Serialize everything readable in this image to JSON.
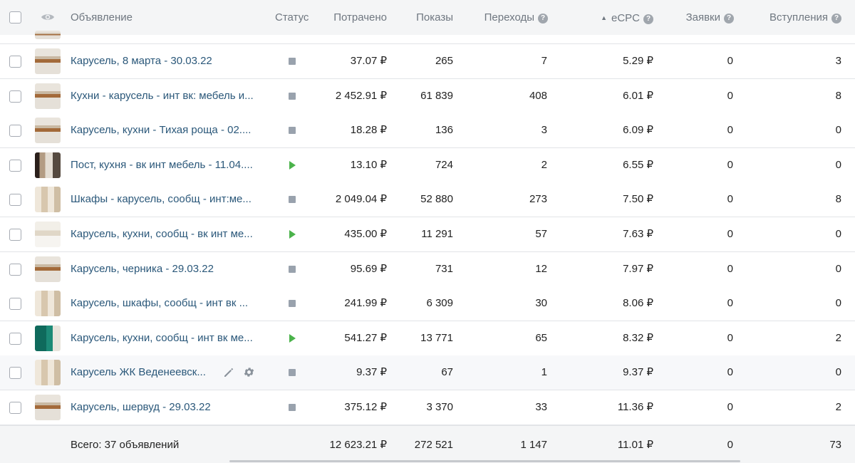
{
  "header": {
    "ad": "Объявление",
    "status": "Статус",
    "spent": "Потрачено",
    "shows": "Показы",
    "clicks": "Переходы",
    "ecpc": "eCPC",
    "leads": "Заявки",
    "joins": "Вступления",
    "help_glyph": "?",
    "sort_glyph": "▲"
  },
  "rows": [
    {
      "name": "Карусель, 8 марта - 30.03.22",
      "status": "stopped",
      "spent": "37.07 ₽",
      "shows": "265",
      "clicks": "7",
      "ecpc": "5.29 ₽",
      "leads": "0",
      "joins": "3",
      "thumb": "t1"
    },
    {
      "name": "Кухни - карусель - инт вк: мебель и...",
      "status": "stopped",
      "spent": "2 452.91 ₽",
      "shows": "61 839",
      "clicks": "408",
      "ecpc": "6.01 ₽",
      "leads": "0",
      "joins": "8",
      "thumb": "t1"
    },
    {
      "name": "Карусель, кухни - Тихая роща - 02....",
      "status": "stopped",
      "spent": "18.28 ₽",
      "shows": "136",
      "clicks": "3",
      "ecpc": "6.09 ₽",
      "leads": "0",
      "joins": "0",
      "thumb": "t1"
    },
    {
      "name": "Пост, кухня - вк инт мебель - 11.04....",
      "status": "active",
      "spent": "13.10 ₽",
      "shows": "724",
      "clicks": "2",
      "ecpc": "6.55 ₽",
      "leads": "0",
      "joins": "0",
      "thumb": "t2"
    },
    {
      "name": "Шкафы - карусель, сообщ - инт:ме...",
      "status": "stopped",
      "spent": "2 049.04 ₽",
      "shows": "52 880",
      "clicks": "273",
      "ecpc": "7.50 ₽",
      "leads": "0",
      "joins": "8",
      "thumb": "t3"
    },
    {
      "name": "Карусель, кухни, сообщ - вк инт ме...",
      "status": "active",
      "spent": "435.00 ₽",
      "shows": "11 291",
      "clicks": "57",
      "ecpc": "7.63 ₽",
      "leads": "0",
      "joins": "0",
      "thumb": "t4"
    },
    {
      "name": "Карусель, черника - 29.03.22",
      "status": "stopped",
      "spent": "95.69 ₽",
      "shows": "731",
      "clicks": "12",
      "ecpc": "7.97 ₽",
      "leads": "0",
      "joins": "0",
      "thumb": "t1"
    },
    {
      "name": "Карусель, шкафы, сообщ - инт вк ...",
      "status": "stopped",
      "spent": "241.99 ₽",
      "shows": "6 309",
      "clicks": "30",
      "ecpc": "8.06 ₽",
      "leads": "0",
      "joins": "0",
      "thumb": "t3"
    },
    {
      "name": "Карусель, кухни, сообщ - инт вк ме...",
      "status": "active",
      "spent": "541.27 ₽",
      "shows": "13 771",
      "clicks": "65",
      "ecpc": "8.32 ₽",
      "leads": "0",
      "joins": "2",
      "thumb": "t5"
    },
    {
      "name": "Карусель ЖК Веденеевск...",
      "status": "stopped",
      "spent": "9.37 ₽",
      "shows": "67",
      "clicks": "1",
      "ecpc": "9.37 ₽",
      "leads": "0",
      "joins": "0",
      "thumb": "t3",
      "hover": true
    },
    {
      "name": "Карусель, шервуд - 29.03.22",
      "status": "stopped",
      "spent": "375.12 ₽",
      "shows": "3 370",
      "clicks": "33",
      "ecpc": "11.36 ₽",
      "leads": "0",
      "joins": "2",
      "thumb": "t1"
    }
  ],
  "footer": {
    "total_label": "Всего: 37 объявлений",
    "spent": "12 623.21 ₽",
    "shows": "272 521",
    "clicks": "1 147",
    "ecpc": "11.01 ₽",
    "leads": "0",
    "joins": "73"
  },
  "colors": {
    "link": "#2b587a",
    "active_status": "#4bb34b",
    "stopped_status": "#99a2ad",
    "header_bg": "#f4f5f6"
  }
}
